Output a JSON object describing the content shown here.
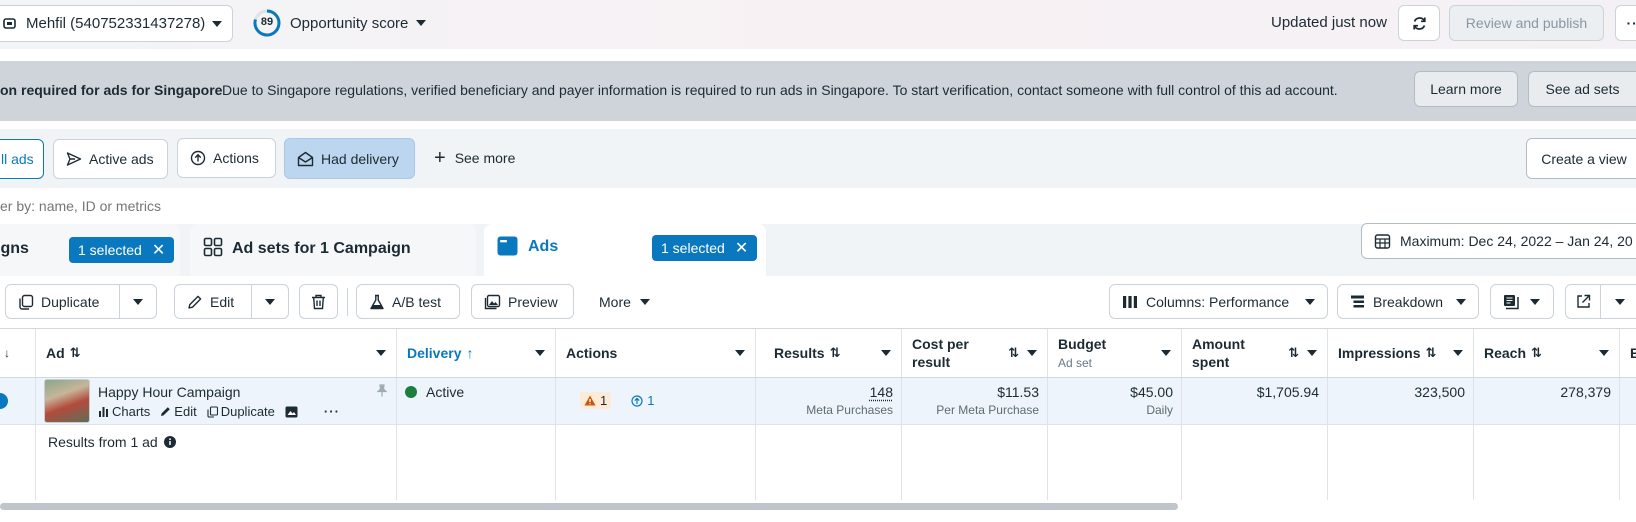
{
  "topbar": {
    "account": "Mehfil (540752331437278)",
    "score_value": "89",
    "score_label": "Opportunity score",
    "updated": "Updated just now",
    "review_publish": "Review and publish"
  },
  "banner": {
    "title": "on required for ads for Singapore",
    "message": "Due to Singapore regulations, verified beneficiary and payer information is required to run ads in Singapore. To start verification, contact someone with full control of this ad account.",
    "learn_more": "Learn more",
    "see_ad_sets": "See ad sets"
  },
  "filters": {
    "all_ads": "ll ads",
    "active_ads": "Active ads",
    "actions": "Actions",
    "had_delivery": "Had delivery",
    "see_more": "See more",
    "create_view": "Create a view"
  },
  "search": {
    "placeholder": "er by: name, ID or metrics"
  },
  "levels": {
    "campaigns": "igns",
    "campaigns_selected": "1 selected",
    "adsets": "Ad sets for 1 Campaign",
    "ads": "Ads",
    "ads_selected": "1 selected",
    "date_range": "Maximum: Dec 24, 2022 – Jan 24, 20"
  },
  "toolbar": {
    "duplicate": "Duplicate",
    "edit": "Edit",
    "ab_test": "A/B test",
    "preview": "Preview",
    "more": "More",
    "columns": "Columns: Performance",
    "breakdown": "Breakdown"
  },
  "table": {
    "headers": {
      "ad": "Ad",
      "delivery": "Delivery",
      "actions": "Actions",
      "results": "Results",
      "cost_per_result_1": "Cost per",
      "cost_per_result_2": "result",
      "budget": "Budget",
      "budget_sub": "Ad set",
      "amount_spent_1": "Amount",
      "amount_spent_2": "spent",
      "impressions": "Impressions",
      "reach": "Reach",
      "next_col": "E"
    },
    "row": {
      "name": "Happy Hour Campaign",
      "charts": "Charts",
      "edit": "Edit",
      "duplicate": "Duplicate",
      "delivery": "Active",
      "warnings": "1",
      "recommendations": "1",
      "results": "148",
      "results_sub": "Meta Purchases",
      "cost_per_result": "$11.53",
      "cost_sub": "Per Meta Purchase",
      "budget": "$45.00",
      "budget_sub": "Daily",
      "amount_spent": "$1,705.94",
      "impressions": "323,500",
      "reach": "278,379"
    },
    "footer": "Results from 1 ad"
  },
  "colors": {
    "accent": "#0a78be",
    "active_green": "#1d7f3f",
    "warning": "#c7580e",
    "selected_row": "#eef4fb",
    "banner_bg": "#cfd4da"
  }
}
